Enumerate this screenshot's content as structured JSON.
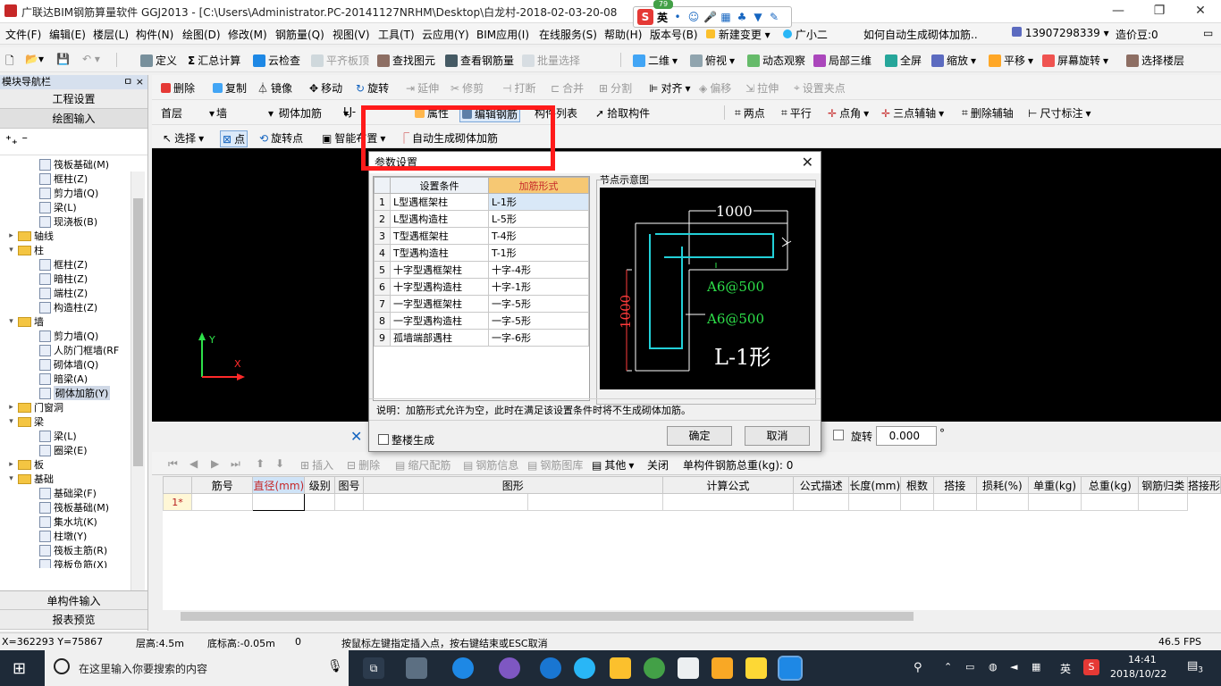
{
  "window": {
    "title": "广联达BIM钢筋算量软件 GGJ2013 - [C:\\Users\\Administrator.PC-20141127NRHM\\Desktop\\白龙村-2018-02-03-20-08",
    "minimize": "—",
    "restore": "❐",
    "close": "✕"
  },
  "ime": {
    "badge": "79",
    "lang": "英"
  },
  "menus": [
    "文件(F)",
    "编辑(E)",
    "楼层(L)",
    "构件(N)",
    "绘图(D)",
    "修改(M)",
    "钢筋量(Q)",
    "视图(V)",
    "工具(T)",
    "云应用(Y)",
    "BIM应用(I)",
    "在线服务(S)",
    "帮助(H)",
    "版本号(B)",
    "新建变更",
    "广小二",
    "如何自动生成砌体加筋..",
    "13907298339",
    "造价豆:0"
  ],
  "toolbar1": [
    "定义",
    "汇总计算",
    "云检查",
    "平齐板顶",
    "查找图元",
    "查看钢筋量",
    "批量选择",
    "二维",
    "俯视",
    "动态观察",
    "局部三维",
    "全屏",
    "缩放",
    "平移",
    "屏幕旋转",
    "选择楼层"
  ],
  "toolbar2": [
    "删除",
    "复制",
    "镜像",
    "移动",
    "旋转",
    "延伸",
    "修剪",
    "打断",
    "合并",
    "分割",
    "对齐",
    "偏移",
    "拉伸",
    "设置夹点"
  ],
  "toolbar3": {
    "floor": "首层",
    "type": "墙",
    "subtype": "砌体加筋",
    "name": "LJ-",
    "items": [
      "属性",
      "编辑钢筋",
      "构件列表",
      "拾取构件",
      "两点",
      "平行",
      "点角",
      "三点辅轴",
      "删除辅轴",
      "尺寸标注"
    ]
  },
  "toolbar4": [
    "选择",
    "点",
    "旋转点",
    "智能布置",
    "自动生成砌体加筋"
  ],
  "sidebar": {
    "title": "模块导航栏",
    "pin": "ㅁ ×",
    "btn_project": "工程设置",
    "btn_draw": "绘图输入",
    "btn_single": "单构件输入",
    "btn_report": "报表预览",
    "tree": [
      {
        "label": "筏板基础(M)",
        "level": 2
      },
      {
        "label": "框柱(Z)",
        "level": 2
      },
      {
        "label": "剪力墙(Q)",
        "level": 2
      },
      {
        "label": "梁(L)",
        "level": 2
      },
      {
        "label": "现浇板(B)",
        "level": 2
      },
      {
        "label": "轴线",
        "level": 1,
        "exp": "+"
      },
      {
        "label": "柱",
        "level": 1,
        "exp": "-"
      },
      {
        "label": "框柱(Z)",
        "level": 2
      },
      {
        "label": "暗柱(Z)",
        "level": 2
      },
      {
        "label": "端柱(Z)",
        "level": 2
      },
      {
        "label": "构造柱(Z)",
        "level": 2
      },
      {
        "label": "墙",
        "level": 1,
        "exp": "-"
      },
      {
        "label": "剪力墙(Q)",
        "level": 2
      },
      {
        "label": "人防门框墙(RF",
        "level": 2
      },
      {
        "label": "砌体墙(Q)",
        "level": 2
      },
      {
        "label": "暗梁(A)",
        "level": 2
      },
      {
        "label": "砌体加筋(Y)",
        "level": 2,
        "selected": true
      },
      {
        "label": "门窗洞",
        "level": 1,
        "exp": "+"
      },
      {
        "label": "梁",
        "level": 1,
        "exp": "-"
      },
      {
        "label": "梁(L)",
        "level": 2
      },
      {
        "label": "圈梁(E)",
        "level": 2
      },
      {
        "label": "板",
        "level": 1,
        "exp": "+"
      },
      {
        "label": "基础",
        "level": 1,
        "exp": "-"
      },
      {
        "label": "基础梁(F)",
        "level": 2
      },
      {
        "label": "筏板基础(M)",
        "level": 2
      },
      {
        "label": "集水坑(K)",
        "level": 2
      },
      {
        "label": "柱墩(Y)",
        "level": 2
      },
      {
        "label": "筏板主筋(R)",
        "level": 2
      },
      {
        "label": "筏板负筋(X)",
        "level": 2
      }
    ]
  },
  "canvas": {
    "axis_x": "X",
    "axis_y": "Y"
  },
  "propstrip": {
    "rotate_label": "旋转",
    "rotate_value": "0.000",
    "degree": "°"
  },
  "grid_toolbar": [
    "插入",
    "删除",
    "缩尺配筋",
    "钢筋信息",
    "钢筋图库",
    "其他",
    "关闭"
  ],
  "grid_toolbar_total": "单构件钢筋总重(kg): 0",
  "grid": {
    "columns": [
      "筋号",
      "直径(mm)",
      "级别",
      "图号",
      "图形",
      "计算公式",
      "公式描述",
      "长度(mm)",
      "根数",
      "搭接",
      "损耗(%)",
      "单重(kg)",
      "总重(kg)",
      "钢筋归类",
      "搭接形"
    ],
    "row_label": "1*"
  },
  "status": {
    "coords": "X=362293 Y=75867",
    "floor_height": "层高:4.5m",
    "bottom_elev": "底标高:-0.05m",
    "zero": "0",
    "hint": "按鼠标左键指定插入点，按右键结束或ESC取消",
    "fps": "46.5 FPS"
  },
  "taskbar": {
    "search": "在这里输入你要搜索的内容",
    "lang": "英",
    "time": "14:41",
    "date": "2018/10/22",
    "notif": "3"
  },
  "dialog": {
    "title": "参数设置",
    "col_cond": "设置条件",
    "col_form": "加筋形式",
    "rows": [
      {
        "n": "1",
        "cond": "L型遇框架柱",
        "form": "L-1形"
      },
      {
        "n": "2",
        "cond": "L型遇构造柱",
        "form": "L-5形"
      },
      {
        "n": "3",
        "cond": "T型遇框架柱",
        "form": "T-4形"
      },
      {
        "n": "4",
        "cond": "T型遇构造柱",
        "form": "T-1形"
      },
      {
        "n": "5",
        "cond": "十字型遇框架柱",
        "form": "十字-4形"
      },
      {
        "n": "6",
        "cond": "十字型遇构造柱",
        "form": "十字-1形"
      },
      {
        "n": "7",
        "cond": "一字型遇框架柱",
        "form": "一字-5形"
      },
      {
        "n": "8",
        "cond": "一字型遇构造柱",
        "form": "一字-5形"
      },
      {
        "n": "9",
        "cond": "孤墙端部遇柱",
        "form": "一字-6形"
      }
    ],
    "diagram_title": "节点示意图",
    "diagram": {
      "dim_h": "1000",
      "dim_v": "1000",
      "rebar1": "A6@500",
      "rebar2": "A6@500",
      "shape": "L-1形"
    },
    "note": "说明：加筋形式允许为空，此时在满足该设置条件时将不生成砌体加筋。",
    "checkbox": "整楼生成",
    "ok": "确定",
    "cancel": "取消"
  },
  "colors": {
    "highlight": "#ff1a1a",
    "cyan": "#22d0d8",
    "green": "#2ee04a",
    "red": "#ff3b3b"
  }
}
